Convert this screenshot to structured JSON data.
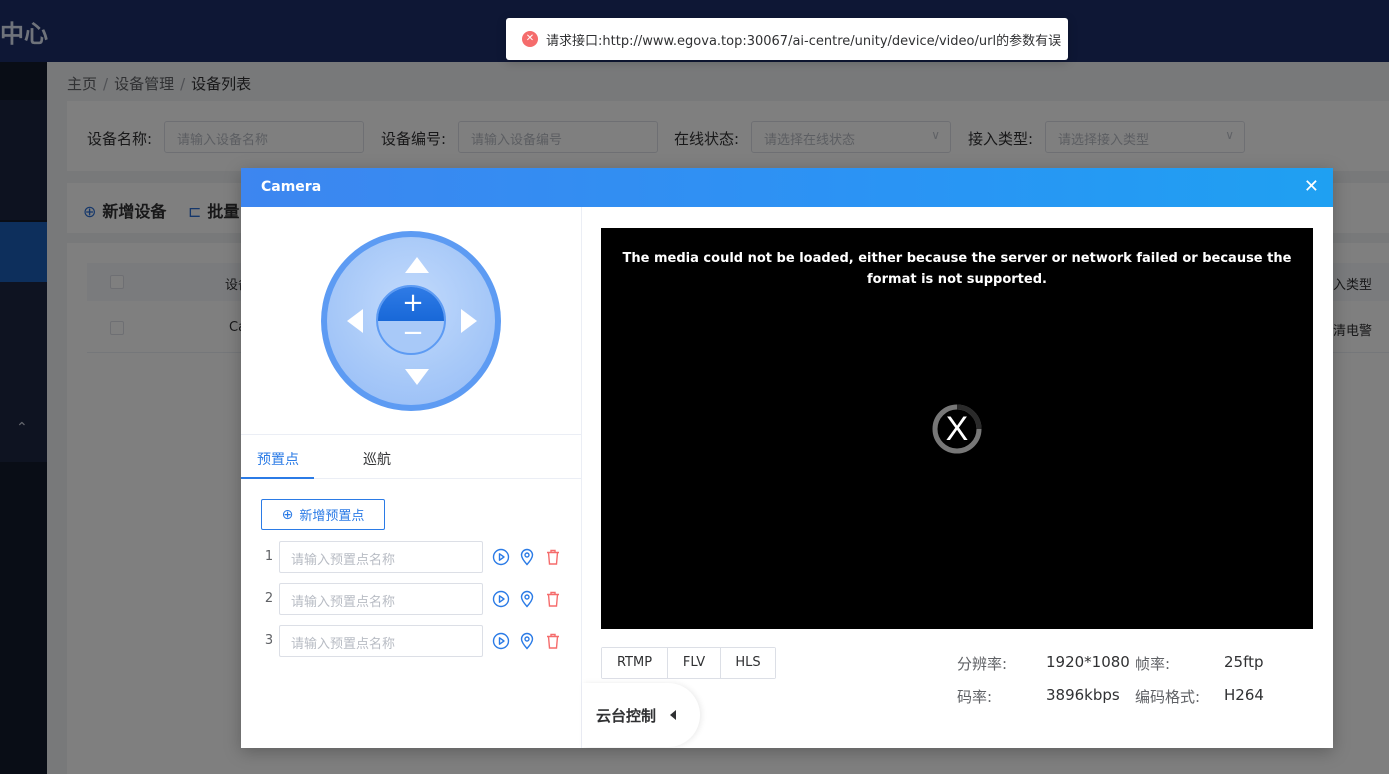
{
  "app": {
    "brand_fragment": "中心"
  },
  "breadcrumb": {
    "home": "主页",
    "section": "设备管理",
    "current": "设备列表",
    "separator": "/"
  },
  "filters": {
    "device_name_label": "设备名称:",
    "device_name_placeholder": "请输入设备名称",
    "device_code_label": "设备编号:",
    "device_code_placeholder": "请输入设备编号",
    "online_label": "在线状态:",
    "online_placeholder": "请选择在线状态",
    "access_label": "接入类型:",
    "access_placeholder": "请选择接入类型"
  },
  "toolbar": {
    "add_label": "新增设备",
    "batch_label": "批量"
  },
  "table": {
    "header_col1": "设备",
    "header_last": "接入类型",
    "row1_col1": "Ca",
    "row1_last": "高清电警"
  },
  "toast": {
    "message": "请求接口:http://www.egova.top:30067/ai-centre/unity/device/video/url的参数有误",
    "icon": "error-icon"
  },
  "dialog": {
    "title": "Camera",
    "tabs": [
      {
        "label": "预置点",
        "active": true
      },
      {
        "label": "巡航",
        "active": false
      }
    ],
    "add_preset_label": "新增预置点",
    "presets": [
      {
        "index": "1",
        "placeholder": "请输入预置点名称"
      },
      {
        "index": "2",
        "placeholder": "请输入预置点名称"
      },
      {
        "index": "3",
        "placeholder": "请输入预置点名称"
      }
    ],
    "video_error": "The media could not be loaded, either because the server or network failed or because the format is not supported.",
    "video_error_glyph": "X",
    "formats": [
      "RTMP",
      "FLV",
      "HLS"
    ],
    "stats": {
      "resolution_label": "分辨率:",
      "resolution_value": "1920*1080",
      "framerate_label": "帧率:",
      "framerate_value": "25ftp",
      "bitrate_label": "码率:",
      "bitrate_value": "3896kbps",
      "codec_label": "编码格式:",
      "codec_value": "H264"
    },
    "ptz_panel_label": "云台控制"
  },
  "colors": {
    "primary": "#2b7be6",
    "danger": "#f56c6c",
    "header_blue": "#2a94f4"
  }
}
